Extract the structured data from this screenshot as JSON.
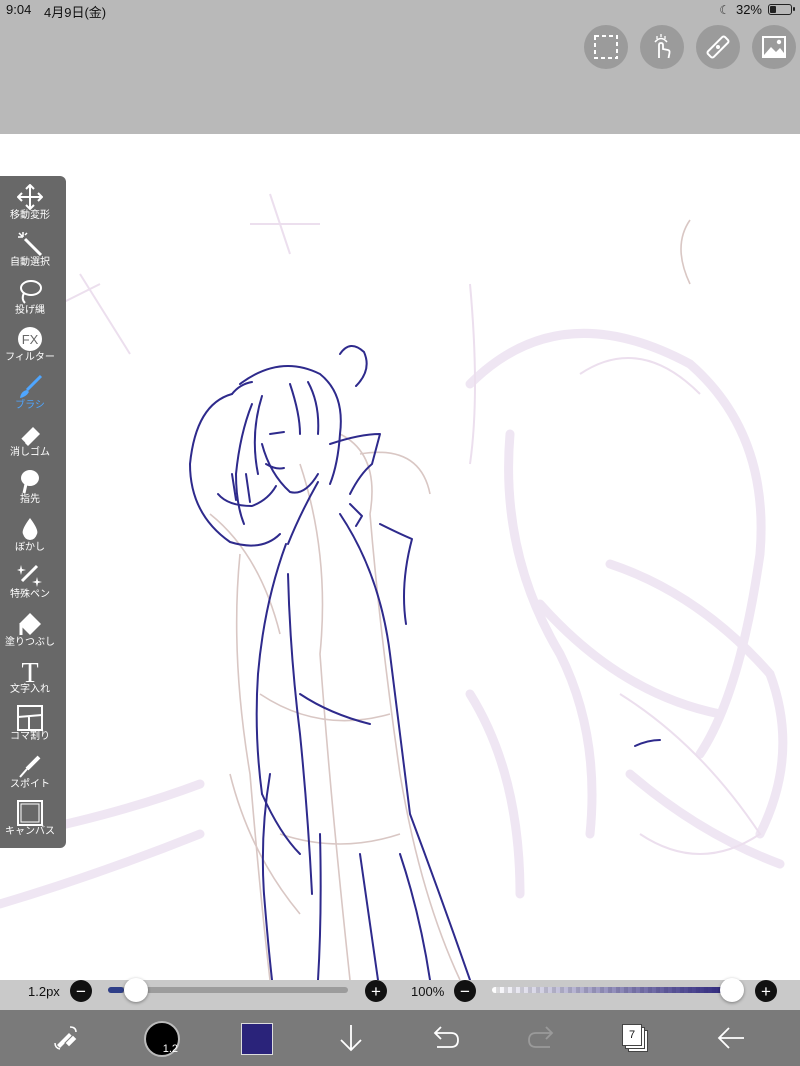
{
  "status": {
    "time": "9:04",
    "date": "4月9日(金)",
    "battery_percent": "32%",
    "battery_level": 0.32
  },
  "top_toolbar": {
    "buttons": [
      {
        "name": "selection-icon"
      },
      {
        "name": "gesture-icon"
      },
      {
        "name": "ruler-icon"
      },
      {
        "name": "image-icon"
      }
    ]
  },
  "tools": [
    {
      "label": "移動変形",
      "icon": "move-icon"
    },
    {
      "label": "自動選択",
      "icon": "magic-wand-icon"
    },
    {
      "label": "投げ縄",
      "icon": "lasso-icon"
    },
    {
      "label": "フィルター",
      "icon": "fx-icon"
    },
    {
      "label": "ブラシ",
      "icon": "brush-icon",
      "active": true
    },
    {
      "label": "消しゴム",
      "icon": "eraser-icon"
    },
    {
      "label": "指先",
      "icon": "smudge-icon"
    },
    {
      "label": "ぼかし",
      "icon": "blur-icon"
    },
    {
      "label": "特殊ペン",
      "icon": "special-pen-icon"
    },
    {
      "label": "塗りつぶし",
      "icon": "bucket-icon"
    },
    {
      "label": "文字入れ",
      "icon": "text-icon"
    },
    {
      "label": "コマ割り",
      "icon": "frame-icon"
    },
    {
      "label": "スポイト",
      "icon": "eyedropper-icon"
    },
    {
      "label": "キャンバス",
      "icon": "canvas-icon"
    }
  ],
  "fx_glyph": "FX",
  "text_glyph": "T",
  "brush_slider": {
    "size_label": "1.2px",
    "minus": "−",
    "plus": "+",
    "level": 0.05
  },
  "opacity_slider": {
    "label": "100%",
    "minus": "−",
    "plus": "+",
    "level": 1.0
  },
  "bottom_toolbar": {
    "brush_size_value": "1.2",
    "current_color": "#2a237a",
    "layer_count": "7"
  },
  "colors": {
    "toolbar_bg": "#b9b9b9",
    "panel_bg": "#686868",
    "active_tool": "#4fa6ff",
    "line_art": "#2e2a8c",
    "sketch": "#d9c7c4"
  }
}
